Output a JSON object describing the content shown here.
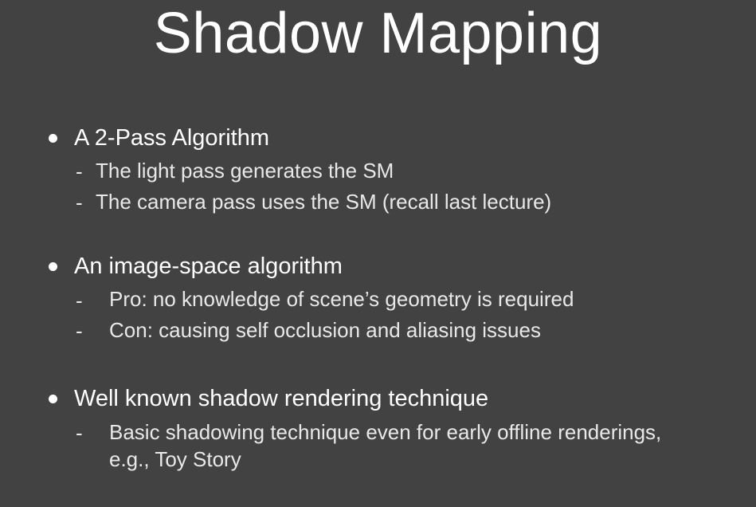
{
  "slide": {
    "title": "Shadow Mapping",
    "sections": [
      {
        "heading": "A 2-Pass Algorithm",
        "items": [
          "The light pass generates the SM",
          "The camera pass uses the SM (recall last lecture)"
        ]
      },
      {
        "heading": "An image-space algorithm",
        "items": [
          "Pro: no knowledge of scene’s geometry is required",
          "Con: causing self occlusion and aliasing issues"
        ]
      },
      {
        "heading": "Well known shadow rendering technique",
        "items": [
          "Basic shadowing technique even for early offline renderings,",
          "e.g., Toy Story"
        ]
      }
    ],
    "bullet_glyph": "•",
    "dash_glyph": "-",
    "colors": {
      "background": "#424242",
      "text": "#ffffff"
    }
  }
}
